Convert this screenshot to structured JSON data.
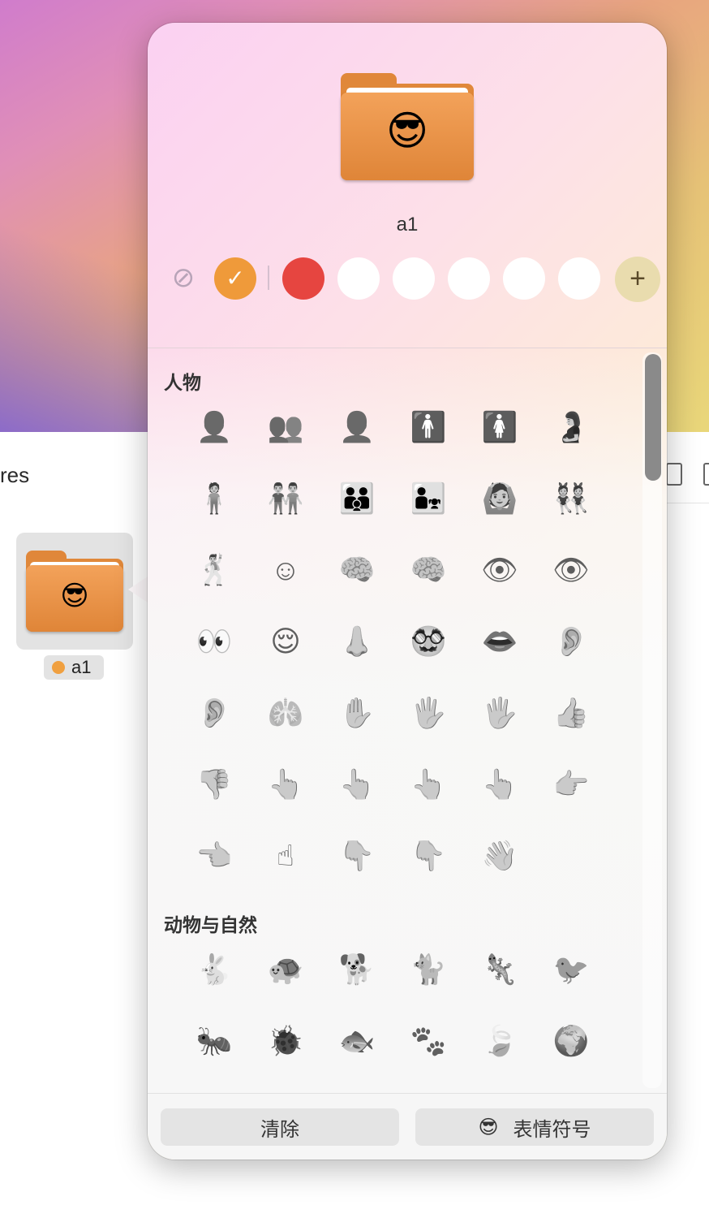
{
  "background_window": {
    "title_fragment": "res",
    "file": {
      "name": "a1",
      "tag_color": "#f0a040",
      "emoji": "😎"
    }
  },
  "popover": {
    "folder_emoji": "😎",
    "folder_name": "a1",
    "tags": {
      "no_tag_icon": "tag-slash-icon",
      "colors": [
        "#ef9a3a",
        "#e64540",
        "#ffffff",
        "#ffffff",
        "#ffffff",
        "#ffffff",
        "#ffffff"
      ],
      "selected": "#ef9a3a",
      "check_glyph": "✓",
      "add_glyph": "+"
    },
    "sections": [
      {
        "title": "人物",
        "icons": [
          "👤",
          "👥",
          "👤",
          "🚹",
          "🚺",
          "🤰",
          "🧍",
          "👬",
          "👪",
          "👨‍👧",
          "🙆",
          "👯",
          "🕺",
          "☺",
          "🧠",
          "🧠",
          "👁",
          "👁",
          "👀",
          "😌",
          "👃",
          "🥸",
          "👄",
          "👂",
          "👂",
          "🫁",
          "✋",
          "🖐",
          "🖐",
          "👍",
          "👎",
          "👆",
          "👆",
          "👆",
          "👆",
          "👉",
          "👈",
          "☝",
          "👇",
          "👇",
          "👋"
        ]
      },
      {
        "title": "动物与自然",
        "icons": [
          "🐇",
          "🐢",
          "🐕",
          "🐈",
          "🦎",
          "🐦",
          "🐜",
          "🐞",
          "🐟",
          "🐾",
          "🍃",
          "🌍"
        ]
      }
    ],
    "footer": {
      "clear_label": "清除",
      "emoji_label": "表情符号",
      "emoji_glyph": "😎"
    }
  }
}
